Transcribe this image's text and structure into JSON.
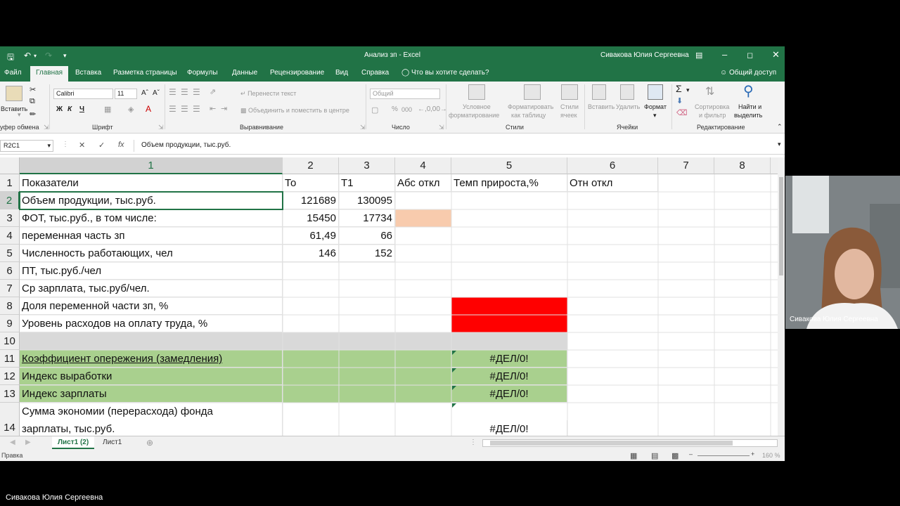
{
  "titlebar": {
    "title": "Анализ зп  -  Excel",
    "user": "Сивакова Юлия Сергеевна",
    "save_icon": "save-icon",
    "undo_icon": "undo-icon"
  },
  "menu": {
    "tabs": [
      "Файл",
      "Главная",
      "Вставка",
      "Разметка страницы",
      "Формулы",
      "Данные",
      "Рецензирование",
      "Вид",
      "Справка"
    ],
    "active": "Главная",
    "tell_me": "Что вы хотите сделать?",
    "share": "Общий доступ"
  },
  "ribbon": {
    "paste": "Вставить",
    "clipboard": "уфер обмена",
    "font_name": "Calibri",
    "font_size": "11",
    "font_group": "Шрифт",
    "bold": "Ж",
    "italic": "К",
    "underline": "Ч",
    "wrap": "Перенести текст",
    "merge": "Объединить и поместить в центре",
    "align_group": "Выравнивание",
    "number_format": "Общий",
    "number_group": "Число",
    "cond_format_1": "Условное",
    "cond_format_2": "форматирование",
    "format_table_1": "Форматировать",
    "format_table_2": "как таблицу",
    "cell_styles_1": "Стили",
    "cell_styles_2": "ячеек",
    "styles_group": "Стили",
    "insert": "Вставить",
    "delete": "Удалить",
    "format": "Формат",
    "cells_group": "Ячейки",
    "sort_1": "Сортировка",
    "sort_2": "и фильтр",
    "find_1": "Найти и",
    "find_2": "выделить",
    "edit_group": "Редактирование"
  },
  "formula_bar": {
    "name_box": "R2C1",
    "content": "Объем продукции, тыс.руб."
  },
  "grid": {
    "columns": [
      "1",
      "2",
      "3",
      "4",
      "5",
      "6",
      "7",
      "8"
    ],
    "rows": [
      "1",
      "2",
      "3",
      "4",
      "5",
      "6",
      "7",
      "8",
      "9",
      "10",
      "11",
      "12",
      "13",
      "14"
    ],
    "cells": {
      "r1c1": "Показатели",
      "r1c2": "То",
      "r1c3": "Т1",
      "r1c4": "Абс откл",
      "r1c5": "Темп прироста,%",
      "r1c6": "Отн откл",
      "r2c1": "Объем продукции, тыс.руб.",
      "r2c2": "121689",
      "r2c3": "130095",
      "r3c1": "ФОТ, тыс.руб., в том числе:",
      "r3c2": "15450",
      "r3c3": "17734",
      "r4c1": "переменная часть зп",
      "r4c2": "61,49",
      "r4c3": "66",
      "r5c1": "Численность работающих, чел",
      "r5c2": "146",
      "r5c3": "152",
      "r6c1": "ПТ, тыс.руб./чел",
      "r7c1": "Ср зарплата, тыс.руб/чел.",
      "r8c1": "Доля переменной части зп, %",
      "r9c1": "Уровень расходов на оплату труда, %",
      "r11c1": "Коэффициент опережения (замедления)",
      "r11c5": "#ДЕЛ/0!",
      "r12c1": "Индекс выработки",
      "r12c5": "#ДЕЛ/0!",
      "r13c1": "Индекс зарплаты",
      "r13c5": "#ДЕЛ/0!",
      "r14c1a": "Сумма экономии (перерасхода) фонда",
      "r14c1b": "зарплаты, тыс.руб.",
      "r14c5": "#ДЕЛ/0!"
    }
  },
  "sheets": [
    "Лист1 (2)",
    "Лист1"
  ],
  "active_sheet": "Лист1 (2)",
  "status": {
    "ready": "Правка",
    "zoom": "160 %"
  },
  "webcam": {
    "name": "Сивакова Юлия Сергеевна"
  },
  "speaker": {
    "name": "Сивакова Юлия Сергеевна"
  },
  "colors": {
    "excel_green": "#217346",
    "fill_green": "#a9d08e",
    "fill_red": "#ff0000",
    "fill_peach": "#f8cbad",
    "fill_gray": "#d9d9d9"
  }
}
